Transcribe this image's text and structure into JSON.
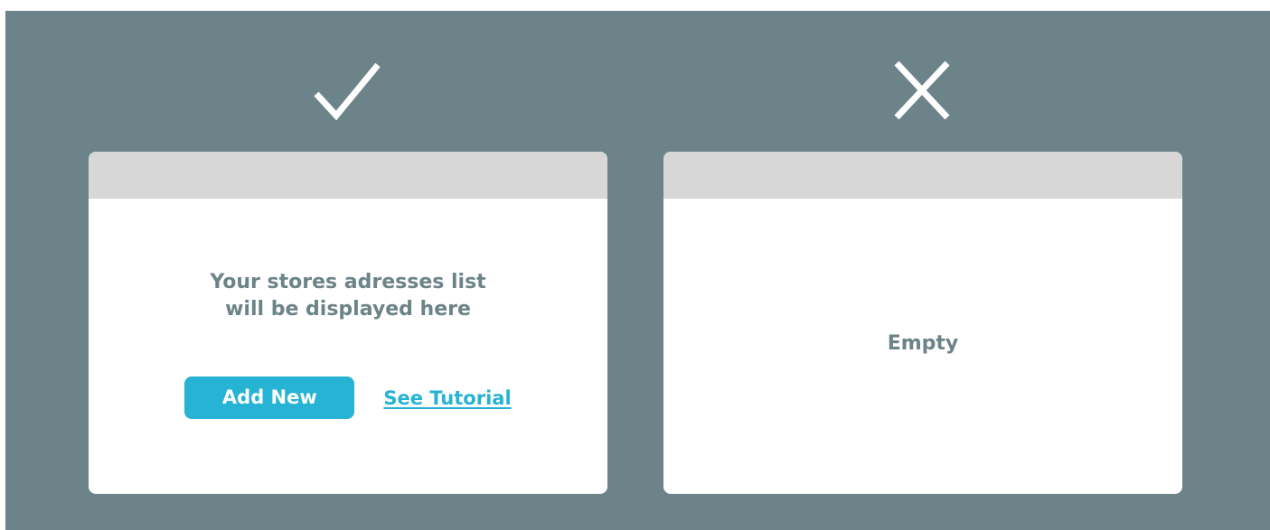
{
  "good_example": {
    "indicator_icon": "checkmark-icon",
    "message_lines": [
      "Your stores adresses list",
      "will be displayed here"
    ],
    "add_button_label": "Add New",
    "tutorial_link_label": "See Tutorial"
  },
  "bad_example": {
    "indicator_icon": "cross-icon",
    "empty_label": "Empty"
  },
  "colors": {
    "background": "#6c8489",
    "card": "#ffffff",
    "card_header": "#d7d7d7",
    "accent": "#27b3d3",
    "text": "#6c8489"
  }
}
